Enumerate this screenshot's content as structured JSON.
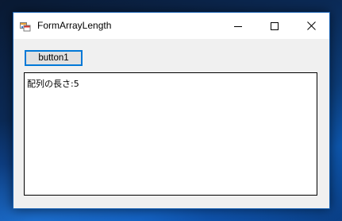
{
  "window": {
    "title": "FormArrayLength",
    "icons": {
      "app": "winforms-app-icon",
      "minimize": "minimize-icon",
      "maximize": "maximize-icon",
      "close": "close-icon"
    }
  },
  "form": {
    "button1_label": "button1",
    "output_text": "配列の長さ:5"
  },
  "colors": {
    "accent": "#0078d7",
    "window_bg": "#f0f0f0",
    "titlebar_bg": "#ffffff"
  }
}
